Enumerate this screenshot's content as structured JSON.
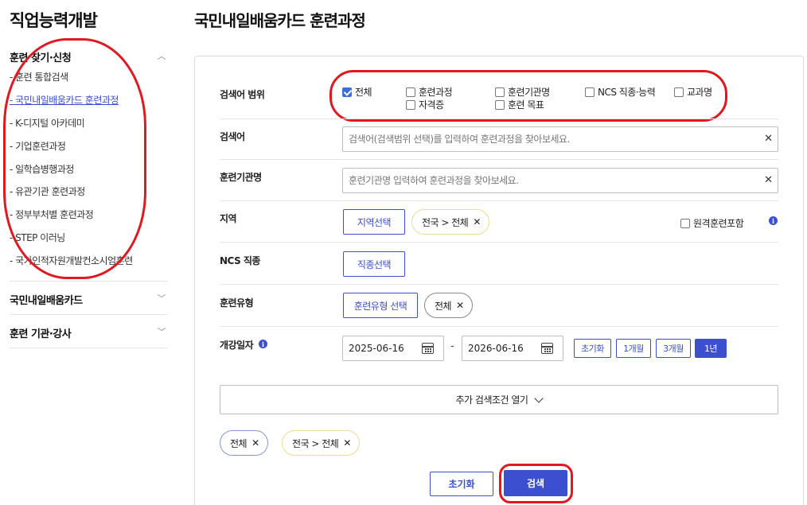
{
  "sidebar": {
    "title": "직업능력개발",
    "sections": [
      {
        "label": "훈련 찾기·신청",
        "expanded": true
      },
      {
        "label": "국민내일배움카드",
        "expanded": false
      },
      {
        "label": "훈련 기관·강사",
        "expanded": false
      }
    ],
    "items": [
      {
        "label": "- 훈련 통합검색",
        "active": false
      },
      {
        "label": "- 국민내일배움카드 훈련과정",
        "active": true
      },
      {
        "label": "- K-디지털 아카데미",
        "active": false
      },
      {
        "label": "- 기업훈련과정",
        "active": false
      },
      {
        "label": "- 일학습병행과정",
        "active": false
      },
      {
        "label": "- 유관기관 훈련과정",
        "active": false
      },
      {
        "label": "- 정부부처별 훈련과정",
        "active": false
      },
      {
        "label": "- STEP 이러닝",
        "active": false
      },
      {
        "label": "- 국가인적자원개발컨소시엄훈련",
        "active": false
      }
    ]
  },
  "main": {
    "title": "국민내일배움카드 훈련과정"
  },
  "form": {
    "scope": {
      "label": "검색어 범위",
      "options": [
        {
          "label": "전체",
          "checked": true
        },
        {
          "label": "훈련과정",
          "checked": false
        },
        {
          "label": "훈련기관명",
          "checked": false
        },
        {
          "label": "NCS 직종·능력",
          "checked": false
        },
        {
          "label": "교과명",
          "checked": false
        },
        {
          "label": "자격증",
          "checked": false
        },
        {
          "label": "훈련 목표",
          "checked": false
        }
      ]
    },
    "keyword": {
      "label": "검색어",
      "value": "",
      "placeholder": "검색어(검색범위 선택)를 입력하여 훈련과정을 찾아보세요."
    },
    "institution": {
      "label": "훈련기관명",
      "value": "",
      "placeholder": "훈련기관명 입력하여 훈련과정을 찾아보세요."
    },
    "region": {
      "label": "지역",
      "button": "지역선택",
      "chip": "전국 > 전체",
      "remote_label": "원격훈련포함",
      "remote_checked": false
    },
    "ncs": {
      "label": "NCS 직종",
      "button": "직종선택"
    },
    "type": {
      "label": "훈련유형",
      "button": "훈련유형 선택",
      "chip": "전체"
    },
    "date": {
      "label": "개강일자",
      "start": "2025-06-16",
      "end": "2026-06-16",
      "separator": "-",
      "periods": [
        {
          "label": "초기화",
          "active": false
        },
        {
          "label": "1개월",
          "active": false
        },
        {
          "label": "3개월",
          "active": false
        },
        {
          "label": "1년",
          "active": true
        }
      ]
    },
    "more_label": "추가 검색조건 열기",
    "selected_chips": [
      "전체",
      "전국 > 전체"
    ],
    "reset_label": "초기화",
    "search_label": "검색"
  }
}
